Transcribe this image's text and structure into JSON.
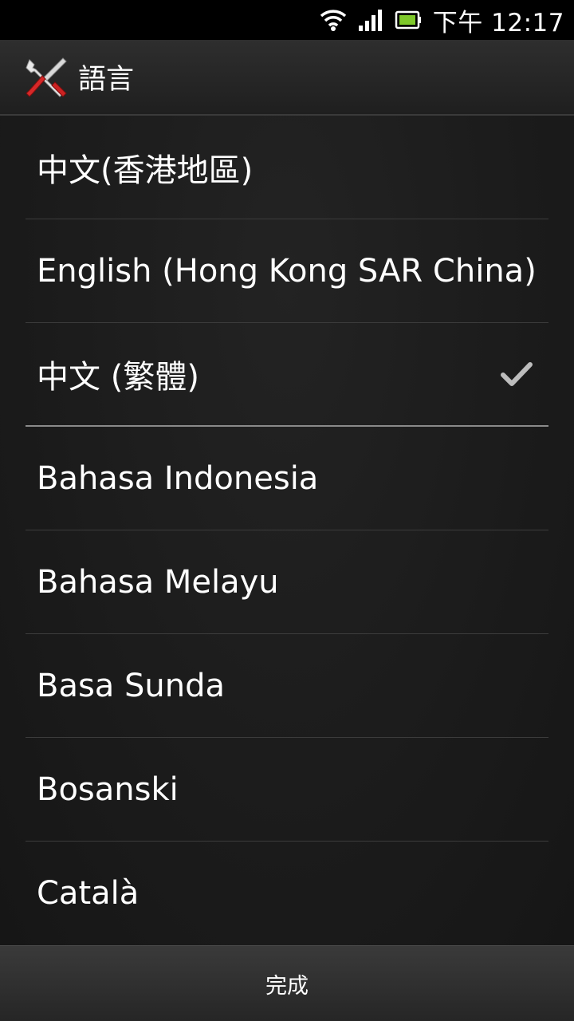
{
  "status_bar": {
    "time": "下午 12:17",
    "icons": [
      "wifi-icon",
      "signal-icon",
      "battery-icon"
    ]
  },
  "title_bar": {
    "icon": "settings-tools-icon",
    "title": "語言"
  },
  "languages": [
    {
      "label": "中文(香港地區)",
      "selected": false
    },
    {
      "label": "English (Hong Kong SAR China)",
      "selected": false
    },
    {
      "label": "中文 (繁體)",
      "selected": true
    },
    {
      "label": "Bahasa Indonesia",
      "selected": false
    },
    {
      "label": "Bahasa Melayu",
      "selected": false
    },
    {
      "label": "Basa Sunda",
      "selected": false
    },
    {
      "label": "Bosanski",
      "selected": false
    },
    {
      "label": "Català",
      "selected": false
    }
  ],
  "bottom_bar": {
    "done_label": "完成"
  },
  "colors": {
    "accent_battery": "#7ec82a",
    "check": "#bdbdbd"
  }
}
